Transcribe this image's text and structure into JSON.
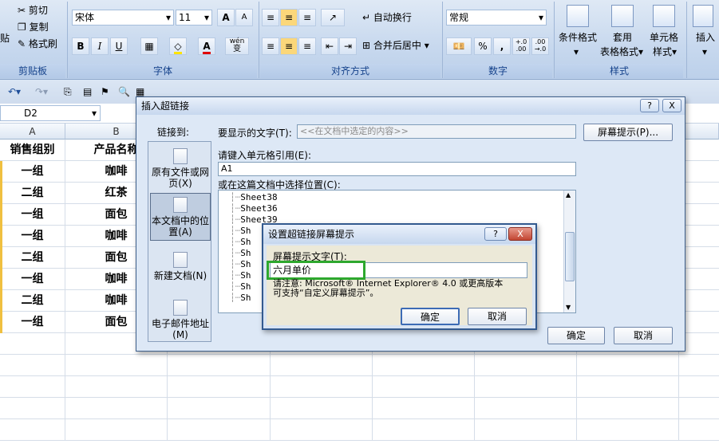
{
  "ribbon": {
    "clipboard": {
      "cut": "剪切",
      "copy": "复制",
      "format_painter": "格式刷",
      "paste_partial": "贴",
      "label": "剪贴板"
    },
    "font": {
      "name": "宋体",
      "size": "11",
      "label": "字体",
      "bold": "B",
      "italic": "I",
      "underline": "U",
      "font_color": "A",
      "wen": "wén",
      "bian": "变",
      "grow": "A",
      "shrink": "A"
    },
    "alignment": {
      "wrap": "自动换行",
      "merge": "合并后居中",
      "label": "对齐方式"
    },
    "number": {
      "format": "常规",
      "percent": "%",
      "comma": ",",
      "inc": "+.0\n.00",
      "dec": ".00\n→.0",
      "label": "数字"
    },
    "styles": {
      "conditional": "条件格式",
      "table_l1": "套用",
      "table_l2": "表格格式",
      "cell_l1": "单元格",
      "cell_l2": "样式",
      "label": "样式"
    },
    "insert": "插入"
  },
  "namebox": "D2",
  "sheet": {
    "columns": [
      "A",
      "B"
    ],
    "rows": [
      [
        "销售组别",
        "产品名称"
      ],
      [
        "一组",
        "咖啡"
      ],
      [
        "二组",
        "红茶"
      ],
      [
        "一组",
        "面包"
      ],
      [
        "一组",
        "咖啡"
      ],
      [
        "二组",
        "面包"
      ],
      [
        "一组",
        "咖啡"
      ],
      [
        "二组",
        "咖啡"
      ],
      [
        "一组",
        "面包"
      ]
    ]
  },
  "dialog": {
    "title": "插入超链接",
    "link_to": "链接到:",
    "nav": [
      {
        "label": "原有文件或网页(X)"
      },
      {
        "label": "本文档中的位置(A)"
      },
      {
        "label": "新建文档(N)"
      },
      {
        "label": "电子邮件地址(M)"
      }
    ],
    "display_label": "要显示的文字(T):",
    "display_value": "<<在文档中选定的内容>>",
    "screentip_button": "屏幕提示(P)...",
    "cell_ref_label": "请键入单元格引用(E):",
    "cell_ref_value": "A1",
    "place_label": "或在这篇文档中选择位置(C):",
    "tree": [
      "Sheet38",
      "Sheet36",
      "Sheet39",
      "Sh",
      "Sh",
      "Sh",
      "Sh",
      "Sh",
      "Sh",
      "Sh"
    ],
    "ok": "确定",
    "cancel": "取消",
    "help": "?",
    "close": "X"
  },
  "tip_dialog": {
    "title": "设置超链接屏幕提示",
    "label": "屏幕提示文字(T):",
    "value": "六月单价",
    "note_1": "请注意: Microsoft® Internet Explorer® 4.0 或更高版本",
    "note_2": "可支持“自定义屏幕提示”。",
    "ok": "确定",
    "cancel": "取消",
    "help": "?",
    "close": "X"
  },
  "colors": {
    "highlight_box": "#2ea82e",
    "ribbon_label": "#15428b"
  }
}
